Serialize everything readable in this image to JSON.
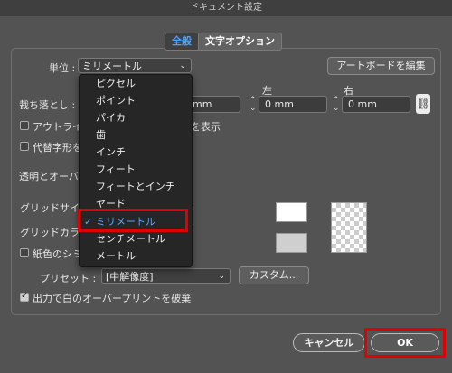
{
  "window": {
    "title": "ドキュメント設定"
  },
  "tabs": [
    "全般",
    "文字オプション"
  ],
  "units": {
    "label": "単位 :",
    "value": "ミリメートル"
  },
  "artboard_button": "アートボードを編集",
  "bleed": {
    "label": "裁ち落とし :",
    "top_value": "mm",
    "left_label": "左",
    "left_value": "0 mm",
    "right_label": "右",
    "right_value": "0 mm"
  },
  "checkboxes": {
    "outline": {
      "label": "アウトライ",
      "suffix": "を表示",
      "checked": false
    },
    "substitute": {
      "label": "代替字形を",
      "checked": false
    },
    "simulate": {
      "label": "紙色のシミ",
      "checked": false
    },
    "discard": {
      "label": "出力で白のオーバープリントを破棄",
      "checked": true
    }
  },
  "transparency_section": "透明とオーバ",
  "grid_size_label": "グリッドサイ",
  "grid_color_label": "グリッドカラ",
  "preset": {
    "label": "プリセット :",
    "value": "[中解像度]",
    "custom_button": "カスタム..."
  },
  "unit_options": [
    "ピクセル",
    "ポイント",
    "パイカ",
    "歯",
    "インチ",
    "フィート",
    "フィートとインチ",
    "ヤード",
    "ミリメートル",
    "センチメートル",
    "メートル"
  ],
  "selected_unit_index": 8,
  "footer": {
    "cancel": "キャンセル",
    "ok": "OK"
  },
  "colors": {
    "accent_blue": "#4aa3ff",
    "highlight_red": "#e10000"
  }
}
